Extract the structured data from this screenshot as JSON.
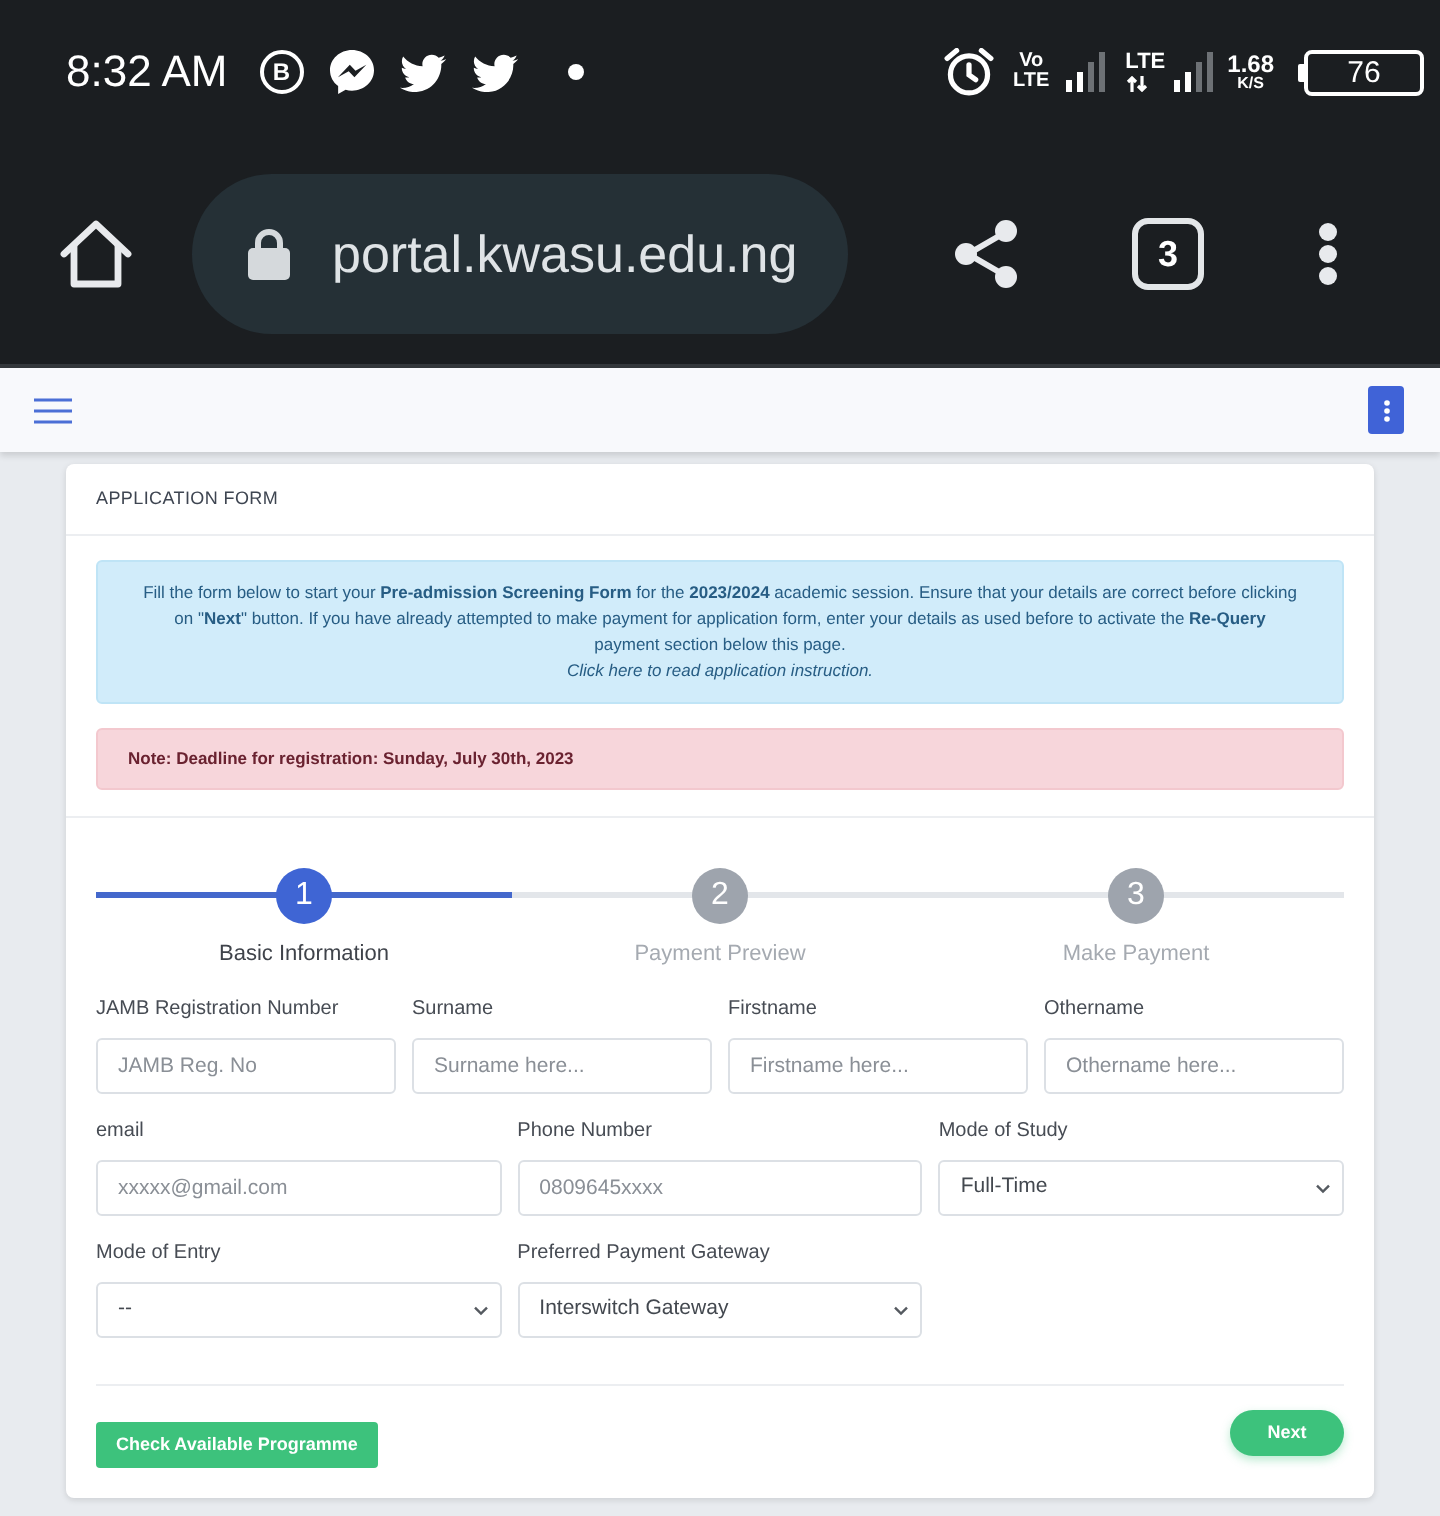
{
  "status_bar": {
    "time": "8:32 AM",
    "notifications": [
      {
        "kind": "business",
        "glyph": "B"
      },
      {
        "kind": "messenger"
      },
      {
        "kind": "bird"
      },
      {
        "kind": "bird"
      },
      {
        "kind": "dot"
      }
    ],
    "volte": {
      "top": "Vo",
      "bottom": "LTE"
    },
    "network": "LTE",
    "data_speed": {
      "value": "1.68",
      "unit": "K/S"
    },
    "battery": "76"
  },
  "browser": {
    "url": "portal.kwasu.edu.ng",
    "tab_count": "3"
  },
  "card": {
    "title": "APPLICATION FORM",
    "notice": "Fill the form below to start your **Pre-admission Screening Form** for the **2023/2024** academic session. Ensure that your details are correct before clicking on \"**Next**\" button. If you have already attempted to make payment for application form, enter your details as used before to activate the **Re-Query** payment section below this page.",
    "instruction": {
      "link": "Click here",
      "text": "to read application instruction."
    },
    "deadline": "Note: Deadline for registration: Sunday, July 30th, 2023"
  },
  "steps": [
    {
      "number": "1",
      "label": "Basic Information",
      "selected": true
    },
    {
      "number": "2",
      "label": "Payment Preview",
      "selected": false
    },
    {
      "number": "3",
      "label": "Make Payment",
      "selected": false
    }
  ],
  "form_rows": [
    [
      {
        "label": "JAMB Registration Number",
        "kind": "input",
        "placeholder": "JAMB Reg. No"
      },
      {
        "label": "Surname",
        "kind": "input",
        "placeholder": "Surname here..."
      },
      {
        "label": "Firstname",
        "kind": "input",
        "placeholder": "Firstname here..."
      },
      {
        "label": "Othername",
        "kind": "input",
        "placeholder": "Othername here..."
      }
    ],
    [
      {
        "label": "email",
        "kind": "input",
        "placeholder": "xxxxx@gmail.com"
      },
      {
        "label": "Phone Number",
        "kind": "input",
        "placeholder": "0809645xxxx"
      },
      {
        "label": "Mode of Study",
        "kind": "select",
        "value": "Full-Time"
      }
    ],
    [
      {
        "label": "Mode of Entry",
        "kind": "select",
        "value": "--"
      },
      {
        "label": "Preferred Payment Gateway",
        "kind": "select",
        "value": "Interswitch Gateway"
      }
    ]
  ],
  "actions": {
    "check_programme": "Check Available Programme",
    "next": "Next"
  }
}
